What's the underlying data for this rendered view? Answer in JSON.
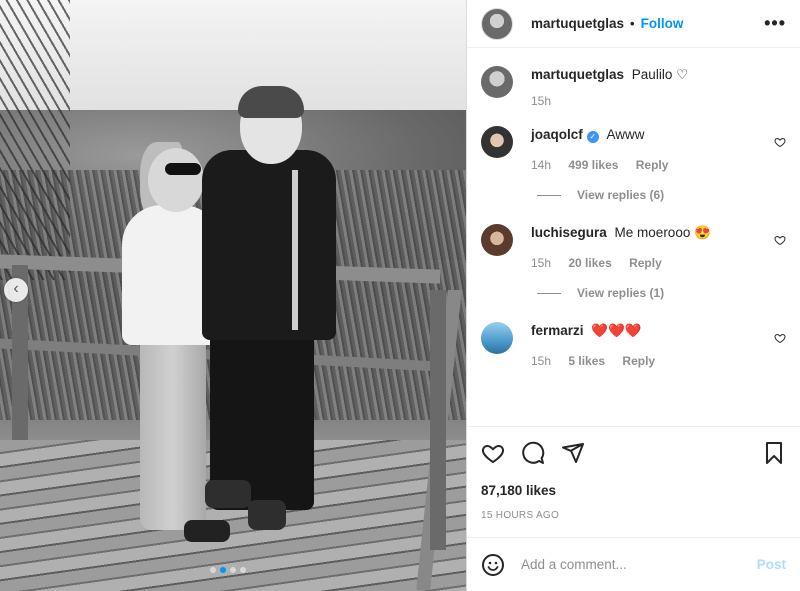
{
  "photo": {
    "carousel_total": 4,
    "carousel_active_index": 2
  },
  "post": {
    "author": "martuquetglas",
    "follow_label": "Follow",
    "separator": "•",
    "more_icon": "more-horizontal-icon",
    "caption": {
      "user": "martuquetglas",
      "text": "Paulilo ♡",
      "time": "15h"
    },
    "likes": "87,180 likes",
    "posted_ago": "15 HOURS AGO"
  },
  "comments": [
    {
      "user": "joaqolcf",
      "verified": true,
      "verified_icon": "verified-badge-icon",
      "text": "Awww",
      "time": "14h",
      "likes": "499 likes",
      "reply_label": "Reply",
      "view_replies": "View replies (6)"
    },
    {
      "user": "luchisegura",
      "verified": false,
      "text": "Me moerooo 😍",
      "time": "15h",
      "likes": "20 likes",
      "reply_label": "Reply",
      "view_replies": "View replies (1)"
    },
    {
      "user": "fermarzi",
      "verified": false,
      "text": "❤️❤️❤️",
      "time": "15h",
      "likes": "5 likes",
      "reply_label": "Reply"
    }
  ],
  "add_comment": {
    "placeholder": "Add a comment...",
    "post_label": "Post",
    "emoji_icon": "emoji-icon"
  },
  "colors": {
    "accent": "#0095f6",
    "post_disabled": "#b3dbff",
    "secondary_text": "#8e8e8e"
  }
}
